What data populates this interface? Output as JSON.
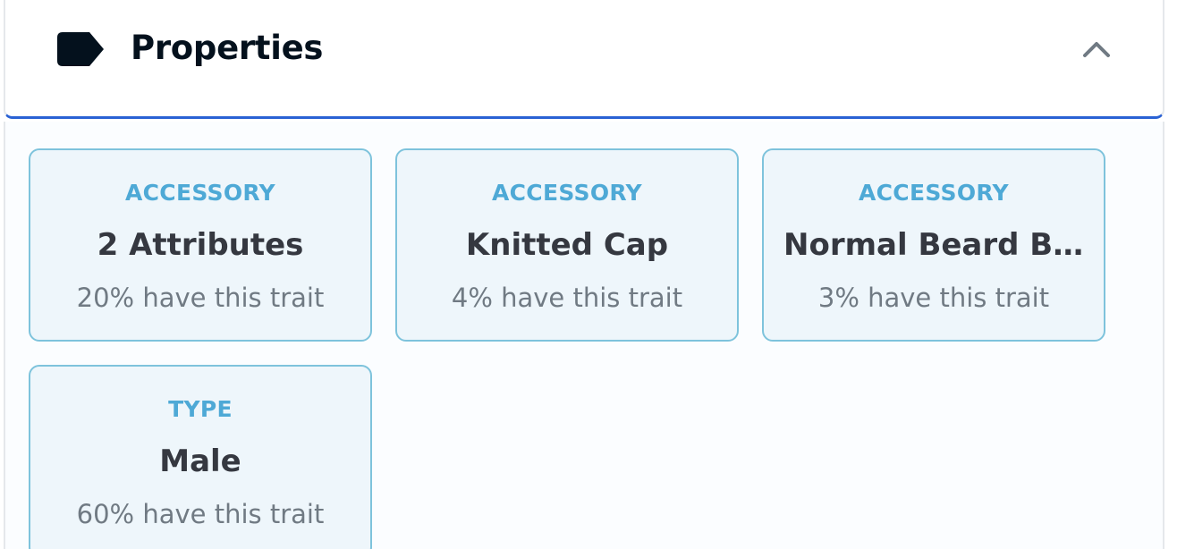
{
  "header": {
    "title": "Properties",
    "icon": "tag-icon",
    "toggle_icon": "chevron-up-icon",
    "accent_color": "#2a62d4"
  },
  "traits": [
    {
      "type": "ACCESSORY",
      "value": "2 Attributes",
      "rarity": "20% have this trait"
    },
    {
      "type": "ACCESSORY",
      "value": "Knitted Cap",
      "rarity": "4% have this trait"
    },
    {
      "type": "ACCESSORY",
      "value": "Normal Beard B...",
      "rarity": "3% have this trait"
    },
    {
      "type": "TYPE",
      "value": "Male",
      "rarity": "60% have this trait"
    }
  ],
  "colors": {
    "card_border": "#7ec3dc",
    "card_background": "#eef6fb",
    "trait_type": "#4ea9d6",
    "trait_value": "#353840",
    "trait_rarity": "#707a83"
  }
}
